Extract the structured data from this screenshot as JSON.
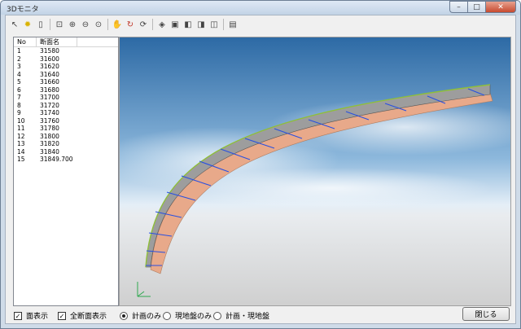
{
  "window": {
    "title": "3Dモニタ",
    "controls": {
      "minimize": "–",
      "maximize": "□",
      "close": "✕"
    }
  },
  "toolbar": {
    "buttons": [
      {
        "name": "select-cursor-icon",
        "glyph": "↖"
      },
      {
        "name": "light-bulb-icon",
        "glyph": "✹"
      },
      {
        "name": "trash-icon",
        "glyph": "▯"
      },
      {
        "name": "zoom-fit-icon",
        "glyph": "⊡"
      },
      {
        "name": "zoom-in-icon",
        "glyph": "⊕"
      },
      {
        "name": "zoom-out-icon",
        "glyph": "⊖"
      },
      {
        "name": "zoom-window-icon",
        "glyph": "⊙"
      },
      {
        "name": "pan-hand-icon",
        "glyph": "✋"
      },
      {
        "name": "rotate-icon",
        "glyph": "↻"
      },
      {
        "name": "rotate-free-icon",
        "glyph": "⟳"
      },
      {
        "name": "view-top-icon",
        "glyph": "◈"
      },
      {
        "name": "view-front-icon",
        "glyph": "▣"
      },
      {
        "name": "view-side-icon",
        "glyph": "◧"
      },
      {
        "name": "view-iso-icon",
        "glyph": "◨"
      },
      {
        "name": "view-reset-icon",
        "glyph": "◫"
      },
      {
        "name": "camera-icon",
        "glyph": "▤"
      }
    ]
  },
  "section_list": {
    "columns": {
      "no": "No",
      "name": "断面名"
    },
    "rows": [
      {
        "no": "1",
        "name": "31580"
      },
      {
        "no": "2",
        "name": "31600"
      },
      {
        "no": "3",
        "name": "31620"
      },
      {
        "no": "4",
        "name": "31640"
      },
      {
        "no": "5",
        "name": "31660"
      },
      {
        "no": "6",
        "name": "31680"
      },
      {
        "no": "7",
        "name": "31700"
      },
      {
        "no": "8",
        "name": "31720"
      },
      {
        "no": "9",
        "name": "31740"
      },
      {
        "no": "10",
        "name": "31760"
      },
      {
        "no": "11",
        "name": "31780"
      },
      {
        "no": "12",
        "name": "31800"
      },
      {
        "no": "13",
        "name": "31820"
      },
      {
        "no": "14",
        "name": "31840"
      },
      {
        "no": "15",
        "name": "31849.700"
      }
    ]
  },
  "options": {
    "show_surface": {
      "label": "面表示",
      "checked": true
    },
    "show_all_sections": {
      "label": "全断面表示",
      "checked": true
    },
    "display_mode": {
      "options": [
        "計画のみ",
        "現地盤のみ",
        "計画・現地盤"
      ],
      "selected": "計画のみ"
    }
  },
  "close_button": "閉じる",
  "colors": {
    "road_surface": "#9d9d9d",
    "slope": "#e8a98a",
    "section_line": "#2850e0",
    "sky_top": "#2d6aa5",
    "sky_bottom": "#e4eef7",
    "ground": "#d3d3d3"
  }
}
